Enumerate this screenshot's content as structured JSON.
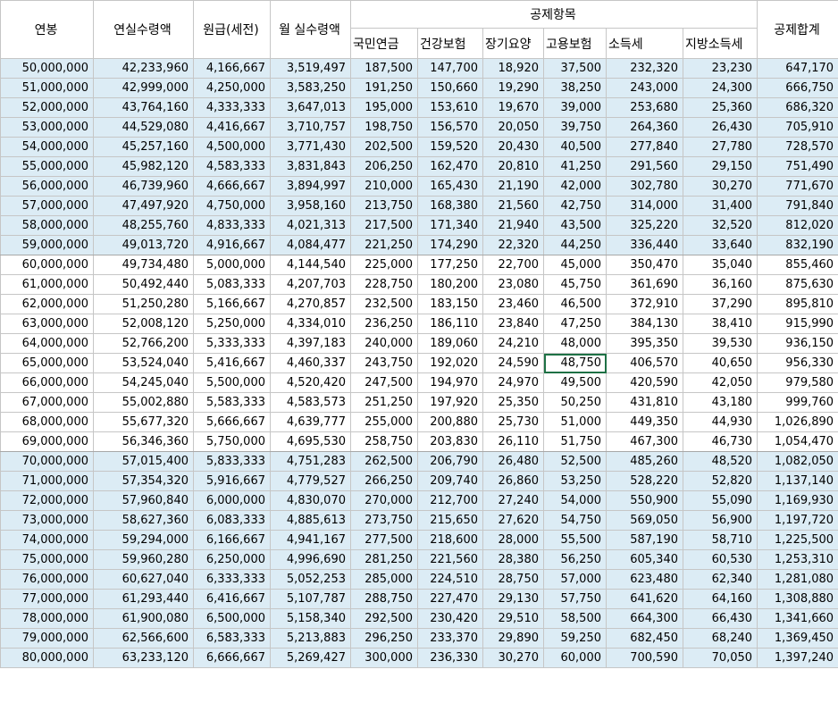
{
  "headers": {
    "salary": "연봉",
    "annual_net": "연실수령액",
    "monthly_gross": "원급(세전)",
    "monthly_net": "월 실수령액",
    "deductions_group": "공제항목",
    "pension": "국민연금",
    "health": "건강보험",
    "longterm_care": "장기요양",
    "employment": "고용보험",
    "income_tax": "소득세",
    "local_tax": "지방소득세",
    "total": "공제합계"
  },
  "selected_cell": {
    "row": 15,
    "column": "employment"
  },
  "rows": [
    {
      "salary": "50,000,000",
      "annual_net": "42,233,960",
      "monthly_gross": "4,166,667",
      "monthly_net": "3,519,497",
      "pension": "187,500",
      "health": "147,700",
      "care": "18,920",
      "employment": "37,500",
      "income_tax": "232,320",
      "local_tax": "23,230",
      "total": "647,170"
    },
    {
      "salary": "51,000,000",
      "annual_net": "42,999,000",
      "monthly_gross": "4,250,000",
      "monthly_net": "3,583,250",
      "pension": "191,250",
      "health": "150,660",
      "care": "19,290",
      "employment": "38,250",
      "income_tax": "243,000",
      "local_tax": "24,300",
      "total": "666,750"
    },
    {
      "salary": "52,000,000",
      "annual_net": "43,764,160",
      "monthly_gross": "4,333,333",
      "monthly_net": "3,647,013",
      "pension": "195,000",
      "health": "153,610",
      "care": "19,670",
      "employment": "39,000",
      "income_tax": "253,680",
      "local_tax": "25,360",
      "total": "686,320"
    },
    {
      "salary": "53,000,000",
      "annual_net": "44,529,080",
      "monthly_gross": "4,416,667",
      "monthly_net": "3,710,757",
      "pension": "198,750",
      "health": "156,570",
      "care": "20,050",
      "employment": "39,750",
      "income_tax": "264,360",
      "local_tax": "26,430",
      "total": "705,910"
    },
    {
      "salary": "54,000,000",
      "annual_net": "45,257,160",
      "monthly_gross": "4,500,000",
      "monthly_net": "3,771,430",
      "pension": "202,500",
      "health": "159,520",
      "care": "20,430",
      "employment": "40,500",
      "income_tax": "277,840",
      "local_tax": "27,780",
      "total": "728,570"
    },
    {
      "salary": "55,000,000",
      "annual_net": "45,982,120",
      "monthly_gross": "4,583,333",
      "monthly_net": "3,831,843",
      "pension": "206,250",
      "health": "162,470",
      "care": "20,810",
      "employment": "41,250",
      "income_tax": "291,560",
      "local_tax": "29,150",
      "total": "751,490"
    },
    {
      "salary": "56,000,000",
      "annual_net": "46,739,960",
      "monthly_gross": "4,666,667",
      "monthly_net": "3,894,997",
      "pension": "210,000",
      "health": "165,430",
      "care": "21,190",
      "employment": "42,000",
      "income_tax": "302,780",
      "local_tax": "30,270",
      "total": "771,670"
    },
    {
      "salary": "57,000,000",
      "annual_net": "47,497,920",
      "monthly_gross": "4,750,000",
      "monthly_net": "3,958,160",
      "pension": "213,750",
      "health": "168,380",
      "care": "21,560",
      "employment": "42,750",
      "income_tax": "314,000",
      "local_tax": "31,400",
      "total": "791,840"
    },
    {
      "salary": "58,000,000",
      "annual_net": "48,255,760",
      "monthly_gross": "4,833,333",
      "monthly_net": "4,021,313",
      "pension": "217,500",
      "health": "171,340",
      "care": "21,940",
      "employment": "43,500",
      "income_tax": "325,220",
      "local_tax": "32,520",
      "total": "812,020"
    },
    {
      "salary": "59,000,000",
      "annual_net": "49,013,720",
      "monthly_gross": "4,916,667",
      "monthly_net": "4,084,477",
      "pension": "221,250",
      "health": "174,290",
      "care": "22,320",
      "employment": "44,250",
      "income_tax": "336,440",
      "local_tax": "33,640",
      "total": "832,190"
    },
    {
      "salary": "60,000,000",
      "annual_net": "49,734,480",
      "monthly_gross": "5,000,000",
      "monthly_net": "4,144,540",
      "pension": "225,000",
      "health": "177,250",
      "care": "22,700",
      "employment": "45,000",
      "income_tax": "350,470",
      "local_tax": "35,040",
      "total": "855,460"
    },
    {
      "salary": "61,000,000",
      "annual_net": "50,492,440",
      "monthly_gross": "5,083,333",
      "monthly_net": "4,207,703",
      "pension": "228,750",
      "health": "180,200",
      "care": "23,080",
      "employment": "45,750",
      "income_tax": "361,690",
      "local_tax": "36,160",
      "total": "875,630"
    },
    {
      "salary": "62,000,000",
      "annual_net": "51,250,280",
      "monthly_gross": "5,166,667",
      "monthly_net": "4,270,857",
      "pension": "232,500",
      "health": "183,150",
      "care": "23,460",
      "employment": "46,500",
      "income_tax": "372,910",
      "local_tax": "37,290",
      "total": "895,810"
    },
    {
      "salary": "63,000,000",
      "annual_net": "52,008,120",
      "monthly_gross": "5,250,000",
      "monthly_net": "4,334,010",
      "pension": "236,250",
      "health": "186,110",
      "care": "23,840",
      "employment": "47,250",
      "income_tax": "384,130",
      "local_tax": "38,410",
      "total": "915,990"
    },
    {
      "salary": "64,000,000",
      "annual_net": "52,766,200",
      "monthly_gross": "5,333,333",
      "monthly_net": "4,397,183",
      "pension": "240,000",
      "health": "189,060",
      "care": "24,210",
      "employment": "48,000",
      "income_tax": "395,350",
      "local_tax": "39,530",
      "total": "936,150"
    },
    {
      "salary": "65,000,000",
      "annual_net": "53,524,040",
      "monthly_gross": "5,416,667",
      "monthly_net": "4,460,337",
      "pension": "243,750",
      "health": "192,020",
      "care": "24,590",
      "employment": "48,750",
      "income_tax": "406,570",
      "local_tax": "40,650",
      "total": "956,330"
    },
    {
      "salary": "66,000,000",
      "annual_net": "54,245,040",
      "monthly_gross": "5,500,000",
      "monthly_net": "4,520,420",
      "pension": "247,500",
      "health": "194,970",
      "care": "24,970",
      "employment": "49,500",
      "income_tax": "420,590",
      "local_tax": "42,050",
      "total": "979,580"
    },
    {
      "salary": "67,000,000",
      "annual_net": "55,002,880",
      "monthly_gross": "5,583,333",
      "monthly_net": "4,583,573",
      "pension": "251,250",
      "health": "197,920",
      "care": "25,350",
      "employment": "50,250",
      "income_tax": "431,810",
      "local_tax": "43,180",
      "total": "999,760"
    },
    {
      "salary": "68,000,000",
      "annual_net": "55,677,320",
      "monthly_gross": "5,666,667",
      "monthly_net": "4,639,777",
      "pension": "255,000",
      "health": "200,880",
      "care": "25,730",
      "employment": "51,000",
      "income_tax": "449,350",
      "local_tax": "44,930",
      "total": "1,026,890"
    },
    {
      "salary": "69,000,000",
      "annual_net": "56,346,360",
      "monthly_gross": "5,750,000",
      "monthly_net": "4,695,530",
      "pension": "258,750",
      "health": "203,830",
      "care": "26,110",
      "employment": "51,750",
      "income_tax": "467,300",
      "local_tax": "46,730",
      "total": "1,054,470"
    },
    {
      "salary": "70,000,000",
      "annual_net": "57,015,400",
      "monthly_gross": "5,833,333",
      "monthly_net": "4,751,283",
      "pension": "262,500",
      "health": "206,790",
      "care": "26,480",
      "employment": "52,500",
      "income_tax": "485,260",
      "local_tax": "48,520",
      "total": "1,082,050"
    },
    {
      "salary": "71,000,000",
      "annual_net": "57,354,320",
      "monthly_gross": "5,916,667",
      "monthly_net": "4,779,527",
      "pension": "266,250",
      "health": "209,740",
      "care": "26,860",
      "employment": "53,250",
      "income_tax": "528,220",
      "local_tax": "52,820",
      "total": "1,137,140"
    },
    {
      "salary": "72,000,000",
      "annual_net": "57,960,840",
      "monthly_gross": "6,000,000",
      "monthly_net": "4,830,070",
      "pension": "270,000",
      "health": "212,700",
      "care": "27,240",
      "employment": "54,000",
      "income_tax": "550,900",
      "local_tax": "55,090",
      "total": "1,169,930"
    },
    {
      "salary": "73,000,000",
      "annual_net": "58,627,360",
      "monthly_gross": "6,083,333",
      "monthly_net": "4,885,613",
      "pension": "273,750",
      "health": "215,650",
      "care": "27,620",
      "employment": "54,750",
      "income_tax": "569,050",
      "local_tax": "56,900",
      "total": "1,197,720"
    },
    {
      "salary": "74,000,000",
      "annual_net": "59,294,000",
      "monthly_gross": "6,166,667",
      "monthly_net": "4,941,167",
      "pension": "277,500",
      "health": "218,600",
      "care": "28,000",
      "employment": "55,500",
      "income_tax": "587,190",
      "local_tax": "58,710",
      "total": "1,225,500"
    },
    {
      "salary": "75,000,000",
      "annual_net": "59,960,280",
      "monthly_gross": "6,250,000",
      "monthly_net": "4,996,690",
      "pension": "281,250",
      "health": "221,560",
      "care": "28,380",
      "employment": "56,250",
      "income_tax": "605,340",
      "local_tax": "60,530",
      "total": "1,253,310"
    },
    {
      "salary": "76,000,000",
      "annual_net": "60,627,040",
      "monthly_gross": "6,333,333",
      "monthly_net": "5,052,253",
      "pension": "285,000",
      "health": "224,510",
      "care": "28,750",
      "employment": "57,000",
      "income_tax": "623,480",
      "local_tax": "62,340",
      "total": "1,281,080"
    },
    {
      "salary": "77,000,000",
      "annual_net": "61,293,440",
      "monthly_gross": "6,416,667",
      "monthly_net": "5,107,787",
      "pension": "288,750",
      "health": "227,470",
      "care": "29,130",
      "employment": "57,750",
      "income_tax": "641,620",
      "local_tax": "64,160",
      "total": "1,308,880"
    },
    {
      "salary": "78,000,000",
      "annual_net": "61,900,080",
      "monthly_gross": "6,500,000",
      "monthly_net": "5,158,340",
      "pension": "292,500",
      "health": "230,420",
      "care": "29,510",
      "employment": "58,500",
      "income_tax": "664,300",
      "local_tax": "66,430",
      "total": "1,341,660"
    },
    {
      "salary": "79,000,000",
      "annual_net": "62,566,600",
      "monthly_gross": "6,583,333",
      "monthly_net": "5,213,883",
      "pension": "296,250",
      "health": "233,370",
      "care": "29,890",
      "employment": "59,250",
      "income_tax": "682,450",
      "local_tax": "68,240",
      "total": "1,369,450"
    },
    {
      "salary": "80,000,000",
      "annual_net": "63,233,120",
      "monthly_gross": "6,666,667",
      "monthly_net": "5,269,427",
      "pension": "300,000",
      "health": "236,330",
      "care": "30,270",
      "employment": "60,000",
      "income_tax": "700,590",
      "local_tax": "70,050",
      "total": "1,397,240"
    }
  ]
}
